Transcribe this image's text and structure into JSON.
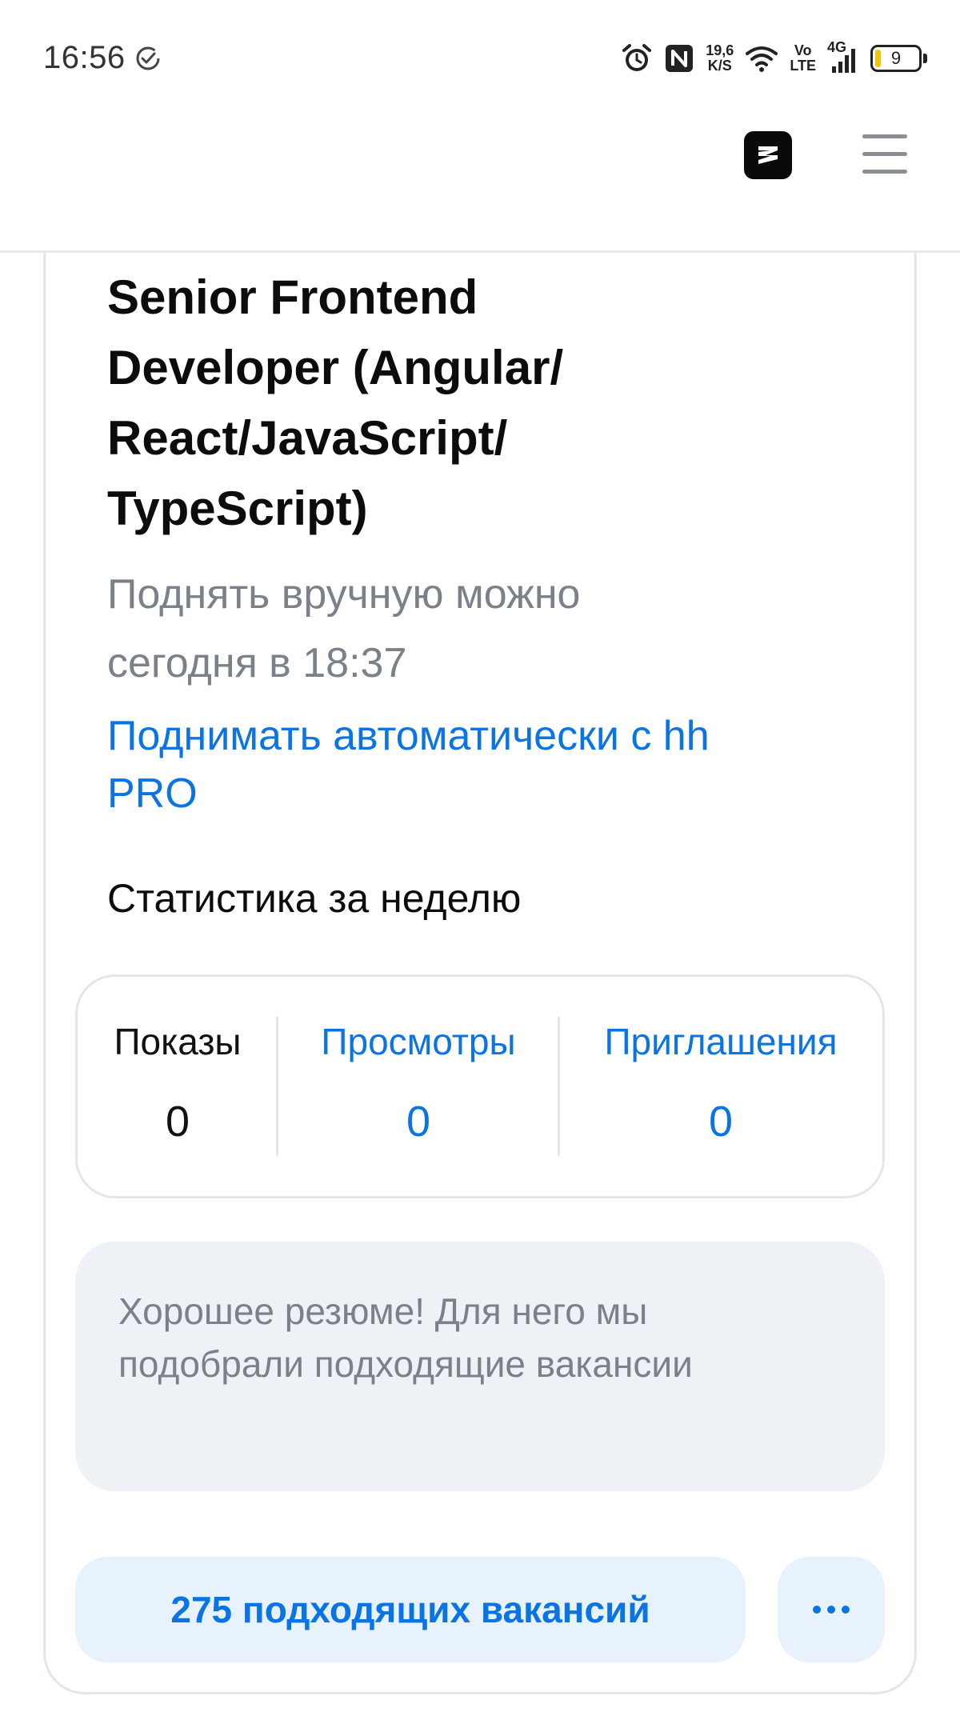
{
  "status_bar": {
    "time": "16:56",
    "network_speed_value": "19,6",
    "network_speed_unit": "K/S",
    "volte_top": "Vo",
    "volte_bottom": "LTE",
    "signal_type": "4G",
    "battery_level": "9",
    "icons": [
      "check-circle-icon",
      "alarm-icon",
      "nfc-icon",
      "wifi-icon",
      "signal-icon",
      "battery-icon"
    ]
  },
  "header": {
    "icons": [
      "app-logo-icon",
      "hamburger-menu-icon"
    ]
  },
  "resume": {
    "title": "Senior Frontend Developer (Angular/ React/JavaScript/ TypeScript)",
    "raise_note": "Поднять вручную можно сегодня в 18:37",
    "auto_raise_link": "Поднимать автоматически с hh PRO"
  },
  "stats": {
    "heading": "Статистика за неделю",
    "items": [
      {
        "label": "Показы",
        "value": "0"
      },
      {
        "label": "Просмотры",
        "value": "0"
      },
      {
        "label": "Приглашения",
        "value": "0"
      }
    ]
  },
  "advice": {
    "text": "Хорошее резюме! Для него мы подобрали подходящие вакансии"
  },
  "actions": {
    "vacancies_button": "275 подходящих вакансий",
    "more_icon": "more-dots-icon"
  },
  "colors": {
    "accent": "#0b74e5",
    "muted_text": "#7b8189",
    "panel_bg": "#eef1f5",
    "button_bg": "#e7f2fd",
    "border": "#e3e6ea",
    "battery_fill": "#f4c20d"
  }
}
